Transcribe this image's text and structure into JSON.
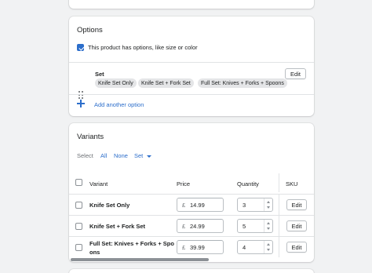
{
  "options": {
    "title": "Options",
    "has_options_label": "This product has options, like size or color",
    "has_options_checked": true,
    "option": {
      "name": "Set",
      "edit_label": "Edit",
      "values": [
        "Knife Set Only",
        "Knife Set + Fork Set",
        "Full Set: Knives + Forks + Spoons"
      ]
    },
    "add_option_label": "Add another option"
  },
  "variants": {
    "title": "Variants",
    "select_label": "Select",
    "select_all": "All",
    "select_none": "None",
    "select_set": "Set",
    "columns": {
      "variant": "Variant",
      "price": "Price",
      "quantity": "Quantity",
      "sku": "SKU"
    },
    "currency": "£",
    "rows": [
      {
        "name": "Knife Set Only",
        "price": "14.99",
        "quantity": "3",
        "edit_label": "Edit"
      },
      {
        "name": "Knife Set + Fork Set",
        "price": "24.99",
        "quantity": "5",
        "edit_label": "Edit"
      },
      {
        "name_line1": "Full Set: Knives + Forks + Spo",
        "name_line2": "ons",
        "price": "39.99",
        "quantity": "4",
        "edit_label": "Edit"
      }
    ]
  }
}
